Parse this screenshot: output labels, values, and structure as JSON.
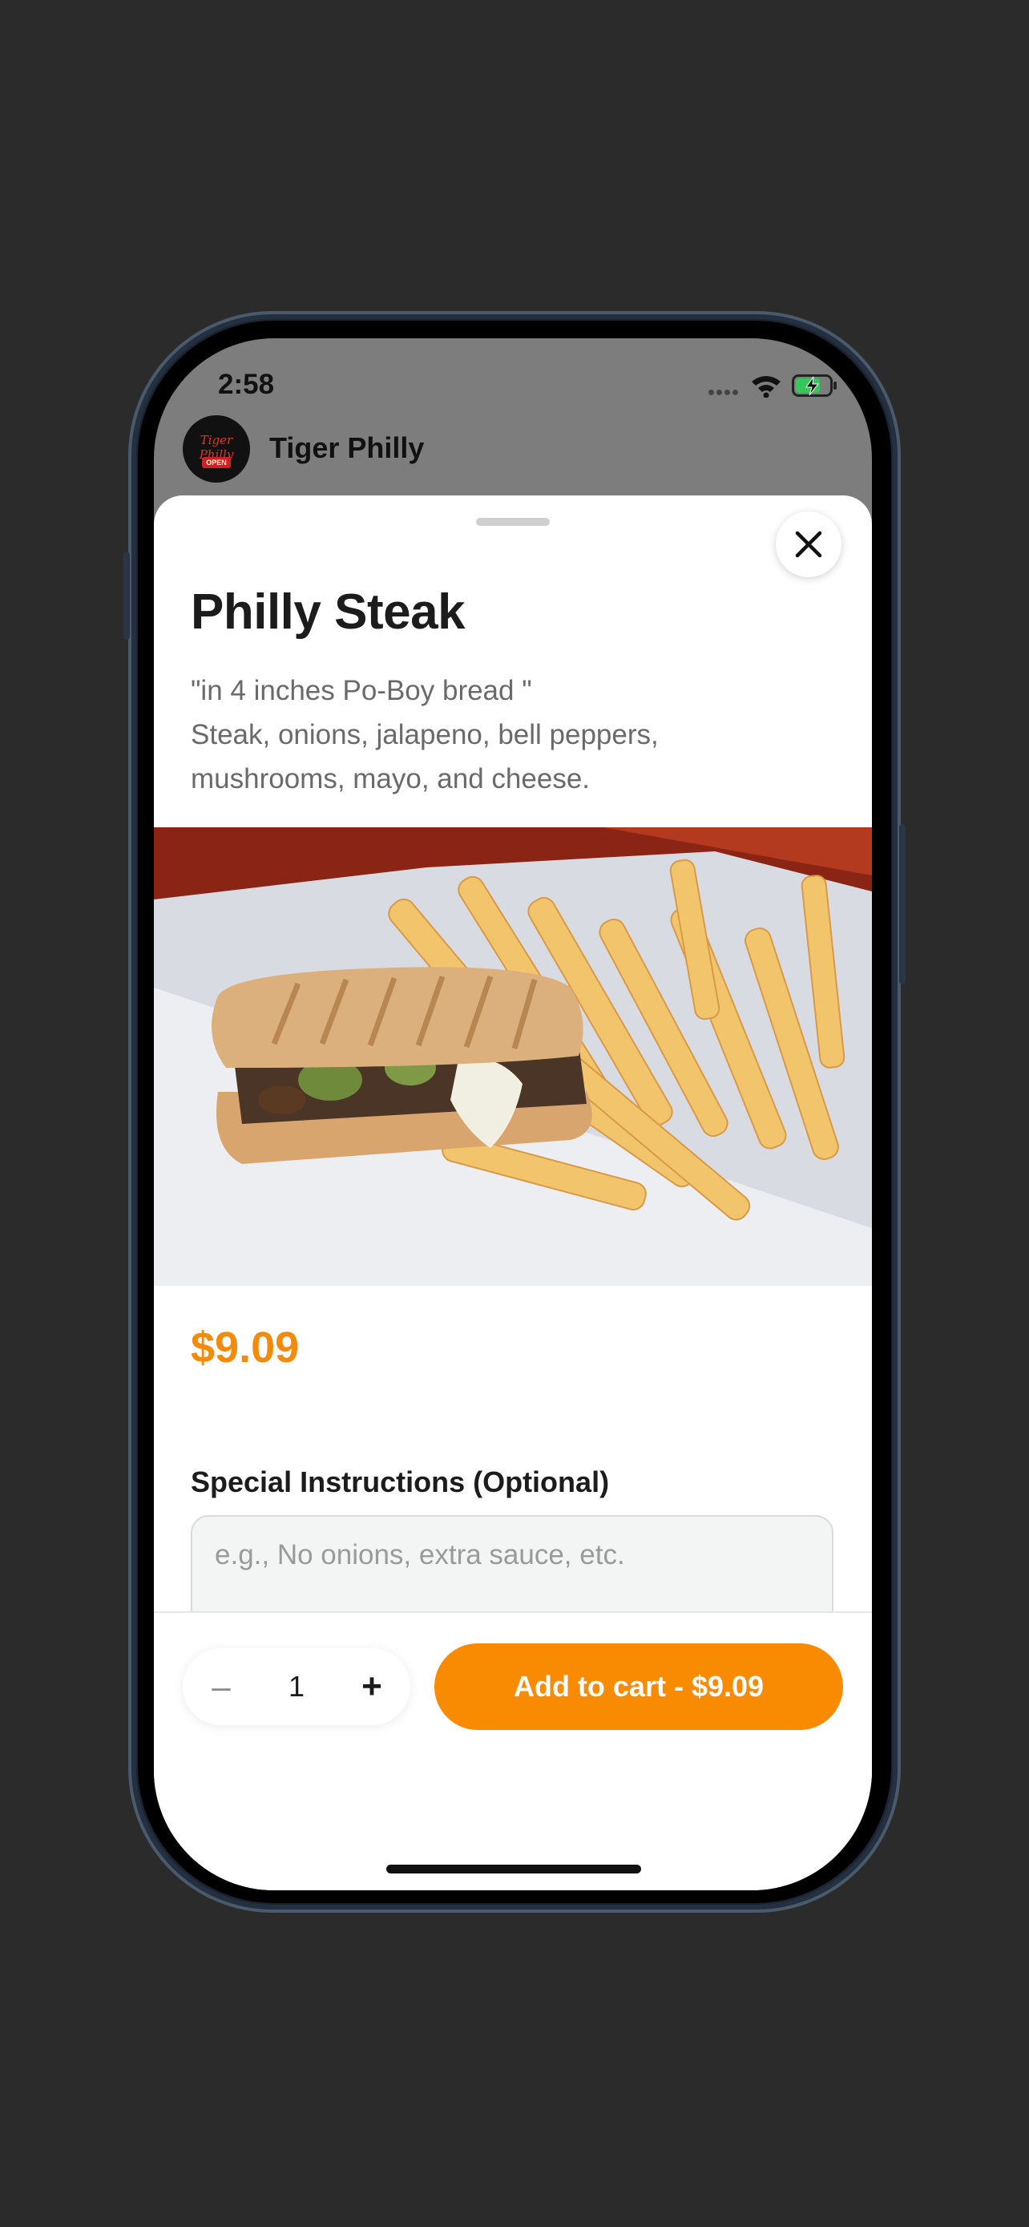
{
  "status_bar": {
    "time": "2:58"
  },
  "store": {
    "name": "Tiger Philly",
    "logo_text": "Tiger Philly",
    "logo_badge": "OPEN"
  },
  "item": {
    "title": "Philly Steak",
    "description": "\"in 4 inches Po-Boy bread \"\nSteak, onions, jalapeno, bell peppers,\nmushrooms, mayo, and cheese.",
    "photo_icon": "philly-steak-sandwich-with-fries",
    "price": "$9.09"
  },
  "instructions": {
    "label": "Special Instructions (Optional)",
    "placeholder": "e.g., No onions, extra sauce, etc.",
    "value": ""
  },
  "cart": {
    "quantity": "1",
    "minus_symbol": "–",
    "plus_symbol": "+",
    "add_label": "Add to cart - $9.09"
  },
  "colors": {
    "accent": "#f98b02",
    "price": "#f28a0c",
    "backdrop": "#2b2b2b",
    "dimmed_header": "#7d7d7d",
    "battery_charge": "#34c759"
  }
}
